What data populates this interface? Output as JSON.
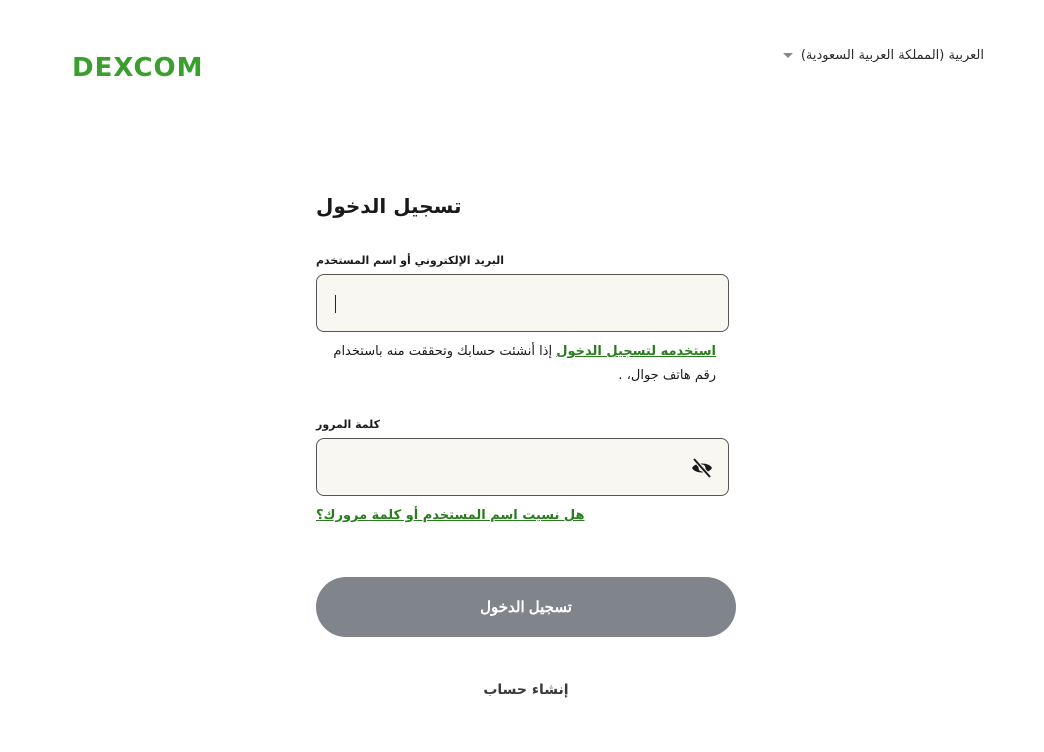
{
  "header": {
    "logo_text": "DEXCOM",
    "brand_color": "#3a9f2e",
    "language_label": "العربية (المملكة العربية السعودية)"
  },
  "login_form": {
    "title": "تسجيل الدخول",
    "email_label": "البريد الإلكتروني أو اسم المستخدم",
    "email_value": "",
    "helper_text_prefix": "إذا أنشئت حسابك وتحققت منه باستخدام رقم هاتف جوال،",
    "helper_link_text": "استخدمه لتسجيل الدخول",
    "helper_text_suffix": ".",
    "password_label": "كلمة المرور",
    "password_value": "",
    "show_password_icon": "eye-slash-icon",
    "forgot_link": "هل نسيت اسم المستخدم أو كلمة مرورك؟",
    "login_button": "تسجيل الدخول",
    "login_button_color": "#80858c",
    "create_account": "إنشاء حساب",
    "link_color": "#2a7d1f"
  }
}
